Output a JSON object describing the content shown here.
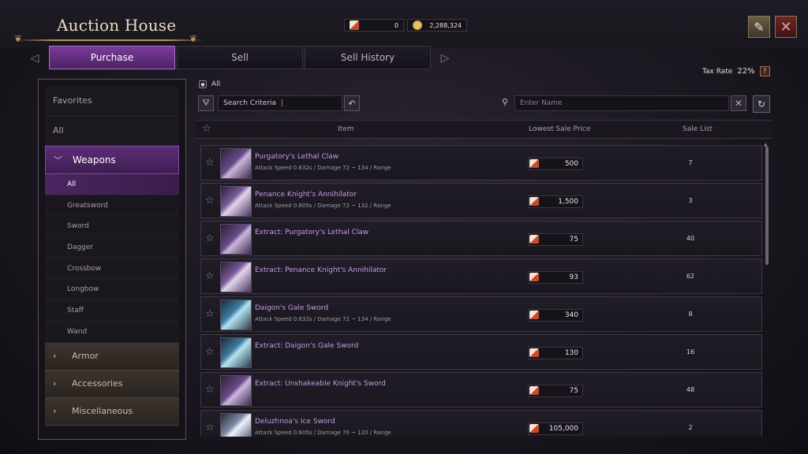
{
  "window": {
    "title": "Auction House"
  },
  "currency": {
    "tickets": "0",
    "gold": "2,288,324"
  },
  "tabs": [
    {
      "label": "Purchase",
      "active": true
    },
    {
      "label": "Sell",
      "active": false
    },
    {
      "label": "Sell History",
      "active": false
    }
  ],
  "tax": {
    "label": "Tax Rate",
    "value": "22%",
    "help": "?"
  },
  "sidebar": {
    "favorites": "Favorites",
    "all": "All",
    "weapons": "Weapons",
    "weapon_types": [
      "All",
      "Greatsword",
      "Sword",
      "Dagger",
      "Crossbow",
      "Longbow",
      "Staff",
      "Wand"
    ],
    "armor": "Armor",
    "accessories": "Accessories",
    "misc": "Miscellaneous"
  },
  "breadcrumb": "All",
  "search": {
    "criteria_label": "Search Criteria",
    "name_placeholder": "Enter Name"
  },
  "table": {
    "headers": {
      "item": "Item",
      "price": "Lowest Sale Price",
      "list": "Sale List"
    },
    "rows": [
      {
        "name": "Purgatory's Lethal Claw",
        "stats": "Attack Speed 0.632s / Damage 72 ~ 134 / Range",
        "price": "500",
        "count": "7",
        "thumb": "claw"
      },
      {
        "name": "Penance Knight's Annihilator",
        "stats": "Attack Speed 0.605s / Damage 72 ~ 132 / Range",
        "price": "1,500",
        "count": "3",
        "thumb": "blade"
      },
      {
        "name": "Extract: Purgatory's Lethal Claw",
        "stats": "",
        "price": "75",
        "count": "40",
        "thumb": "claw"
      },
      {
        "name": "Extract: Penance Knight's Annihilator",
        "stats": "",
        "price": "93",
        "count": "62",
        "thumb": "blade"
      },
      {
        "name": "Daigon's Gale Sword",
        "stats": "Attack Speed 0.632s / Damage 72 ~ 134 / Range",
        "price": "340",
        "count": "8",
        "thumb": "gale"
      },
      {
        "name": "Extract: Daigon's Gale Sword",
        "stats": "",
        "price": "130",
        "count": "16",
        "thumb": "gale"
      },
      {
        "name": "Extract: Unshakeable Knight's Sword",
        "stats": "",
        "price": "75",
        "count": "48",
        "thumb": "claw"
      },
      {
        "name": "Deluzhnoa's Ice Sword",
        "stats": "Attack Speed 0.605s / Damage 70 ~ 120 / Range",
        "price": "105,000",
        "count": "2",
        "thumb": "ice"
      }
    ]
  },
  "colors": {
    "accent_purple": "#7a3c9a",
    "item_name": "#c59ae0",
    "close_red": "#6e2626"
  }
}
